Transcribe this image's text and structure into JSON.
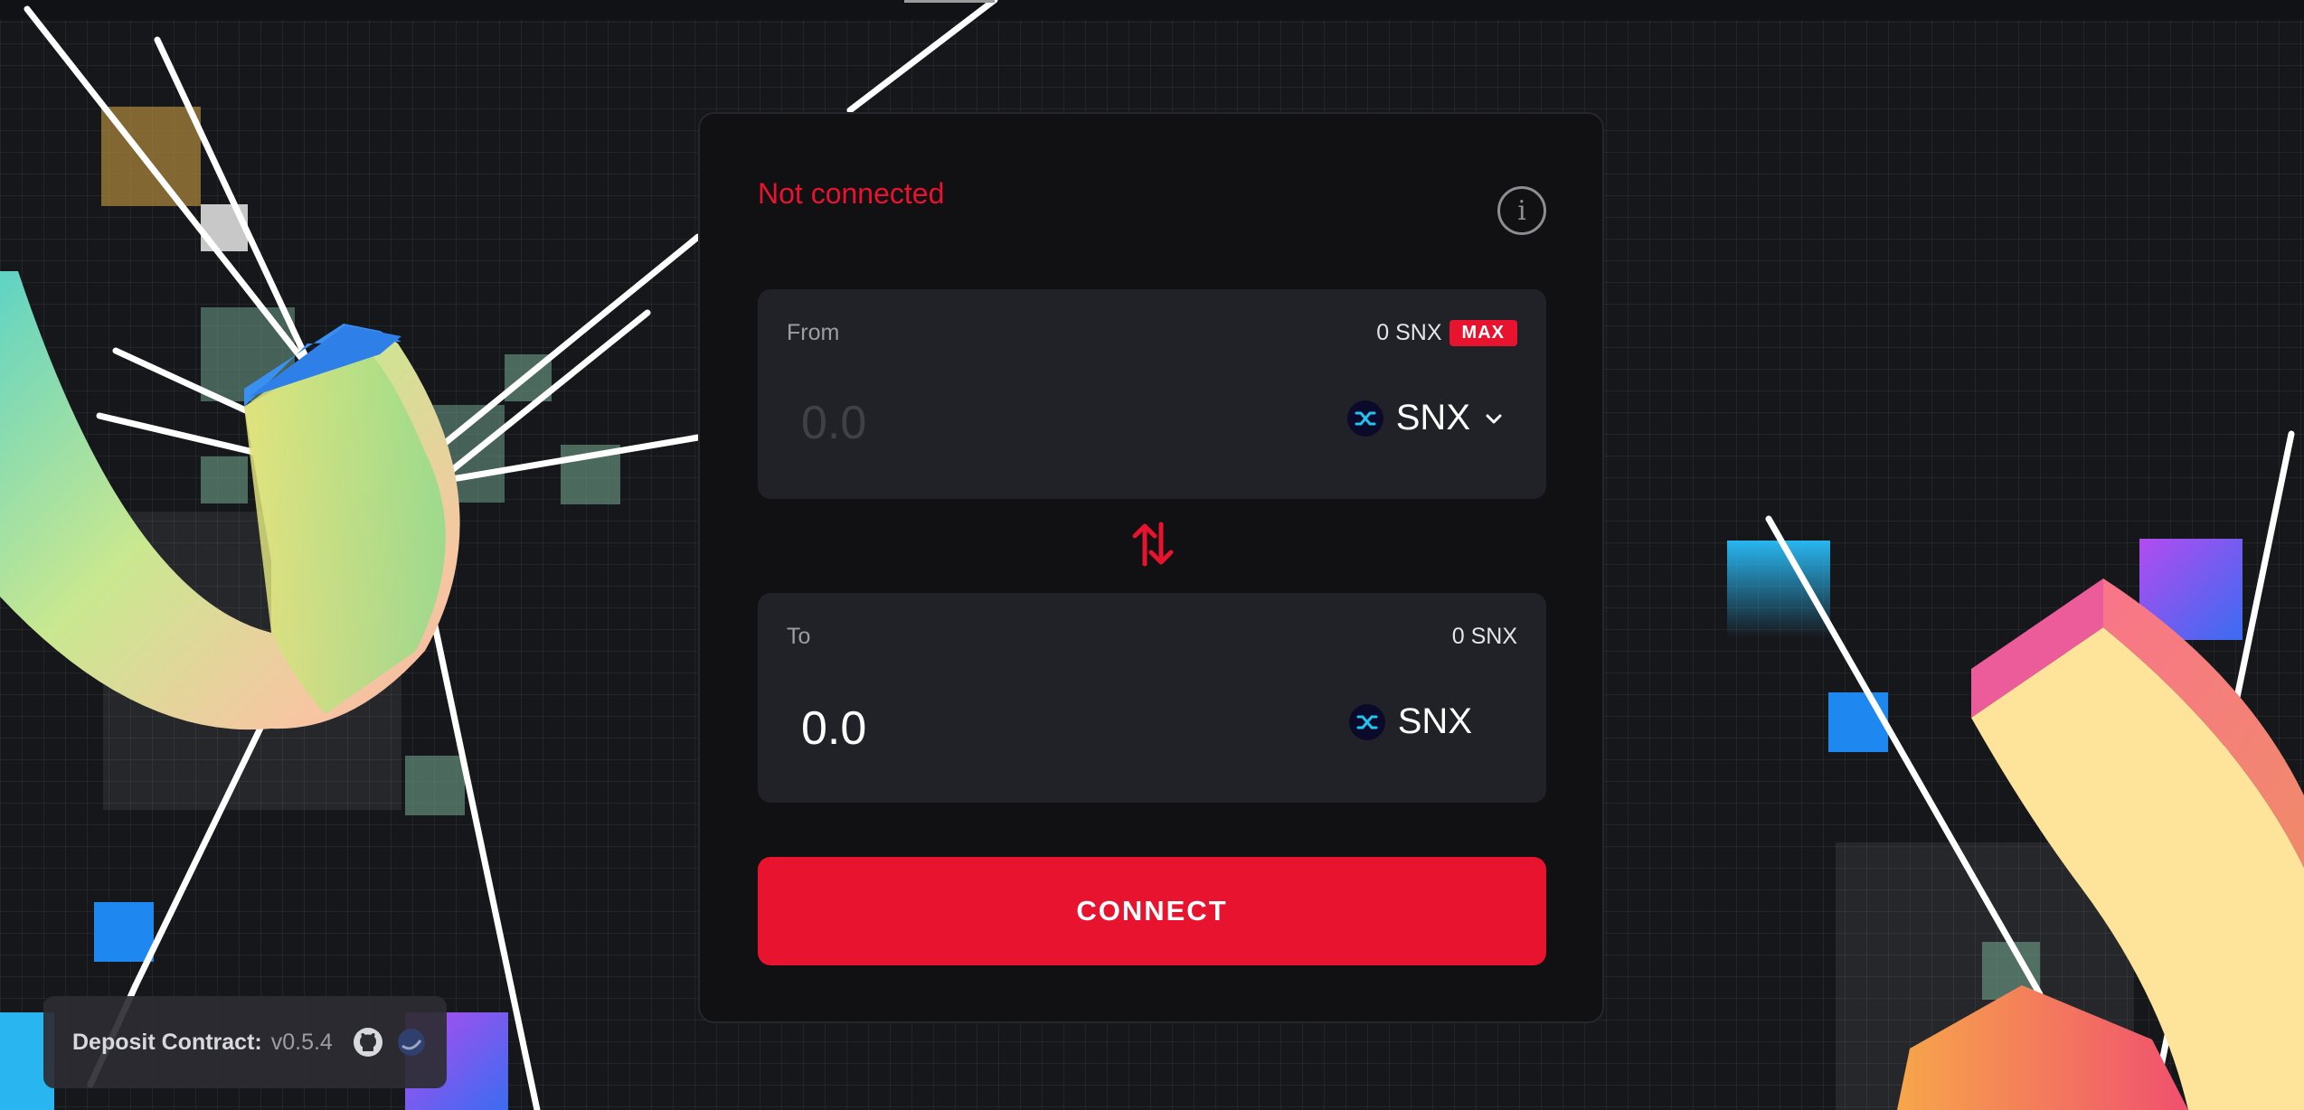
{
  "status": {
    "text": "Not connected",
    "color": "#e8132e"
  },
  "info_icon": "info-icon",
  "from": {
    "label": "From",
    "balance": "0 SNX",
    "max_label": "MAX",
    "amount_placeholder": "0.0",
    "token": "SNX",
    "token_icon": "synthetix-icon"
  },
  "swap_icon": "swap-arrows-icon",
  "to": {
    "label": "To",
    "balance": "0 SNX",
    "amount": "0.0",
    "token": "SNX",
    "token_icon": "synthetix-icon"
  },
  "connect_label": "CONNECT",
  "footer": {
    "label": "Deposit Contract:",
    "version": "v0.5.4",
    "icons": [
      "github-icon",
      "explorer-icon"
    ]
  },
  "colors": {
    "accent": "#e8132e",
    "background": "#16171b",
    "card": "#111113",
    "panel": "#202228"
  }
}
